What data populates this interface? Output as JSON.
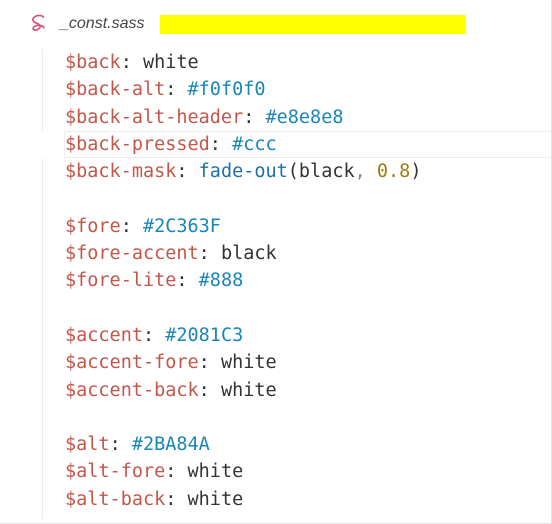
{
  "tab": {
    "icon": "sass-icon",
    "file_name": "_const.sass"
  },
  "lines": [
    {
      "var": "$back",
      "sep": ": ",
      "value": "white",
      "type": "kw"
    },
    {
      "var": "$back-alt",
      "sep": ": ",
      "value": "#f0f0f0",
      "type": "hex"
    },
    {
      "var": "$back-alt-header",
      "sep": ": ",
      "value": "#e8e8e8",
      "type": "hex"
    },
    {
      "var": "$back-pressed",
      "sep": ": ",
      "value": "#ccc",
      "type": "hex"
    },
    {
      "var": "$back-mask",
      "sep": ": ",
      "fn": "fade-out",
      "open": "(",
      "arg1": "black",
      "comma": ",",
      "arg2": " 0.8",
      "close": ")",
      "type": "fn"
    },
    {
      "blank": true
    },
    {
      "var": "$fore",
      "sep": ": ",
      "value": "#2C363F",
      "type": "hex"
    },
    {
      "var": "$fore-accent",
      "sep": ": ",
      "value": "black",
      "type": "kw"
    },
    {
      "var": "$fore-lite",
      "sep": ": ",
      "value": "#888",
      "type": "hex"
    },
    {
      "blank": true
    },
    {
      "var": "$accent",
      "sep": ": ",
      "value": "#2081C3",
      "type": "hex"
    },
    {
      "var": "$accent-fore",
      "sep": ": ",
      "value": "white",
      "type": "kw"
    },
    {
      "var": "$accent-back",
      "sep": ": ",
      "value": "white",
      "type": "kw"
    },
    {
      "blank": true
    },
    {
      "var": "$alt",
      "sep": ": ",
      "value": "#2BA84A",
      "type": "hex"
    },
    {
      "var": "$alt-fore",
      "sep": ": ",
      "value": "white",
      "type": "kw"
    },
    {
      "var": "$alt-back",
      "sep": ": ",
      "value": "white",
      "type": "kw"
    }
  ],
  "colors": {
    "variable": "#c3574b",
    "hex_value": "#1a86b8",
    "keyword": "#333333",
    "function": "#1e6fa6",
    "number": "#9a7d12",
    "sass_icon": "#d0517e",
    "redaction": "#ffff00"
  }
}
